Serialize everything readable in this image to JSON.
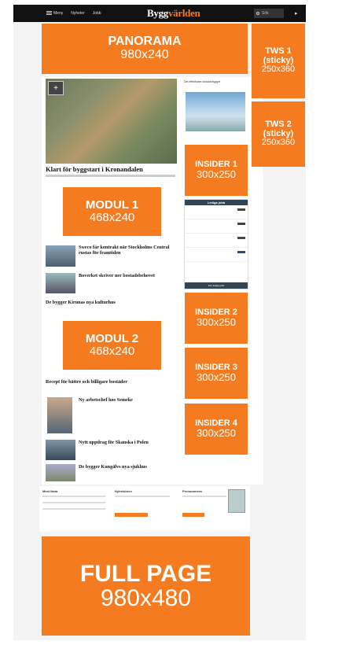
{
  "nav": {
    "menu_label": "Meny",
    "links": [
      "Nyheter",
      "Jobb"
    ],
    "logo_main": "Bygg",
    "logo_accent": "världen",
    "search_placeholder": "Sök",
    "user_symbol": "▸"
  },
  "ads": {
    "panorama": {
      "title": "PANORAMA",
      "size": "980x240"
    },
    "tws1": {
      "title": "TWS 1 (sticky)",
      "size": "250x360"
    },
    "tws2": {
      "title": "TWS 2 (sticky)",
      "size": "250x360"
    },
    "insider1": {
      "title": "INSIDER 1",
      "size": "300x250"
    },
    "insider2": {
      "title": "INSIDER 2",
      "size": "300x250"
    },
    "insider3": {
      "title": "INSIDER 3",
      "size": "300x250"
    },
    "insider4": {
      "title": "INSIDER 4",
      "size": "300x250"
    },
    "modul1": {
      "title": "MODUL 1",
      "size": "468x240"
    },
    "modul2": {
      "title": "MODUL 2",
      "size": "468x240"
    },
    "fullpage": {
      "title": "FULL PAGE",
      "size": "980x480"
    }
  },
  "articles": {
    "hero_title": "Klart för byggstart i Kronandalen",
    "hero_zoom": "+",
    "a1": "Sweco får kontrakt när Stockholms Central rustas för framtiden",
    "a2": "Boverket skriver ner bostadsbehovet",
    "a3": "De bygger Kirunas nya kulturhus",
    "a4": "Recept för bättre och billigare bostäder",
    "a5": "Ny arbetschef hos Semeke",
    "a6": "Nytt uppdrag för Skanska i Polen",
    "a7": "De bygger Kungälvs nya sjukhus"
  },
  "sidebar": {
    "feature_title": "Det effektivare bostadsbygget",
    "jobs_header": "Lediga jobb",
    "jobs_button": "Fler lediga jobb"
  },
  "footer": {
    "col1_title": "Mest lästa",
    "col2_title": "Nyhetsbrev",
    "col3_title": "Prenumerera"
  }
}
